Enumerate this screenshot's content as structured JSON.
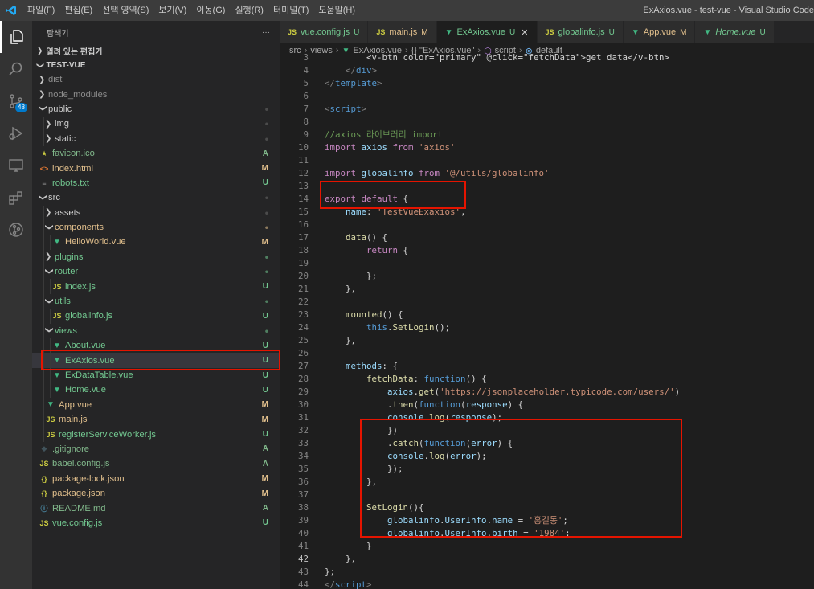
{
  "titlebar": {
    "menus": [
      "파일(F)",
      "편집(E)",
      "선택 영역(S)",
      "보기(V)",
      "이동(G)",
      "실행(R)",
      "터미널(T)",
      "도움말(H)"
    ],
    "window_title": "ExAxios.vue - test-vue - Visual Studio Code"
  },
  "activitybar": {
    "scm_badge": "48"
  },
  "sidebar": {
    "title": "탐색기",
    "more": "···",
    "open_editors": "열려 있는 편집기",
    "project": "TEST-VUE",
    "tree": [
      {
        "depth": 1,
        "type": "folder",
        "open": false,
        "label": "dist",
        "status": "",
        "color": "#8c8c8c"
      },
      {
        "depth": 1,
        "type": "folder",
        "open": false,
        "label": "node_modules",
        "status": "",
        "color": "#8c8c8c"
      },
      {
        "depth": 1,
        "type": "folder",
        "open": true,
        "label": "public",
        "status": "•",
        "color": "#cccccc"
      },
      {
        "depth": 2,
        "type": "folder",
        "open": false,
        "label": "img",
        "status": "•",
        "color": "#cccccc"
      },
      {
        "depth": 2,
        "type": "folder",
        "open": false,
        "label": "static",
        "status": "•",
        "color": "#cccccc"
      },
      {
        "depth": 1,
        "type": "file",
        "icon": "star",
        "label": "favicon.ico",
        "status": "A",
        "color": "#81b88b"
      },
      {
        "depth": 1,
        "type": "file",
        "icon": "html",
        "label": "index.html",
        "status": "M",
        "color": "#e2c08d"
      },
      {
        "depth": 1,
        "type": "file",
        "icon": "txt",
        "label": "robots.txt",
        "status": "U",
        "color": "#73c991"
      },
      {
        "depth": 1,
        "type": "folder",
        "open": true,
        "label": "src",
        "status": "•",
        "color": "#cccccc"
      },
      {
        "depth": 2,
        "type": "folder",
        "open": false,
        "label": "assets",
        "status": "•",
        "color": "#cccccc"
      },
      {
        "depth": 2,
        "type": "folder",
        "open": true,
        "label": "components",
        "status": "•",
        "color": "#e2c08d"
      },
      {
        "depth": 3,
        "type": "file",
        "icon": "vue",
        "label": "HelloWorld.vue",
        "status": "M",
        "color": "#e2c08d"
      },
      {
        "depth": 2,
        "type": "folder",
        "open": false,
        "label": "plugins",
        "status": "•",
        "color": "#73c991"
      },
      {
        "depth": 2,
        "type": "folder",
        "open": true,
        "label": "router",
        "status": "•",
        "color": "#73c991"
      },
      {
        "depth": 3,
        "type": "file",
        "icon": "js",
        "label": "index.js",
        "status": "U",
        "color": "#73c991"
      },
      {
        "depth": 2,
        "type": "folder",
        "open": true,
        "label": "utils",
        "status": "•",
        "color": "#73c991"
      },
      {
        "depth": 3,
        "type": "file",
        "icon": "js",
        "label": "globalinfo.js",
        "status": "U",
        "color": "#73c991"
      },
      {
        "depth": 2,
        "type": "folder",
        "open": true,
        "label": "views",
        "status": "•",
        "color": "#73c991"
      },
      {
        "depth": 3,
        "type": "file",
        "icon": "vue",
        "label": "About.vue",
        "status": "U",
        "color": "#73c991"
      },
      {
        "depth": 3,
        "type": "file",
        "icon": "vue",
        "label": "ExAxios.vue",
        "status": "U",
        "color": "#73c991",
        "selected": true
      },
      {
        "depth": 3,
        "type": "file",
        "icon": "vue",
        "label": "ExDataTable.vue",
        "status": "U",
        "color": "#73c991"
      },
      {
        "depth": 3,
        "type": "file",
        "icon": "vue",
        "label": "Home.vue",
        "status": "U",
        "color": "#73c991"
      },
      {
        "depth": 2,
        "type": "file",
        "icon": "vue",
        "label": "App.vue",
        "status": "M",
        "color": "#e2c08d"
      },
      {
        "depth": 2,
        "type": "file",
        "icon": "js",
        "label": "main.js",
        "status": "M",
        "color": "#e2c08d"
      },
      {
        "depth": 2,
        "type": "file",
        "icon": "js",
        "label": "registerServiceWorker.js",
        "status": "U",
        "color": "#73c991"
      },
      {
        "depth": 1,
        "type": "file",
        "icon": "git",
        "label": ".gitignore",
        "status": "A",
        "color": "#81b88b"
      },
      {
        "depth": 1,
        "type": "file",
        "icon": "js",
        "label": "babel.config.js",
        "status": "A",
        "color": "#81b88b"
      },
      {
        "depth": 1,
        "type": "file",
        "icon": "json",
        "label": "package-lock.json",
        "status": "M",
        "color": "#e2c08d"
      },
      {
        "depth": 1,
        "type": "file",
        "icon": "json",
        "label": "package.json",
        "status": "M",
        "color": "#e2c08d"
      },
      {
        "depth": 1,
        "type": "file",
        "icon": "info",
        "label": "README.md",
        "status": "A",
        "color": "#81b88b"
      },
      {
        "depth": 1,
        "type": "file",
        "icon": "js",
        "label": "vue.config.js",
        "status": "U",
        "color": "#73c991"
      }
    ]
  },
  "tabs": [
    {
      "icon": "js",
      "label": "vue.config.js",
      "flag": "U"
    },
    {
      "icon": "js",
      "label": "main.js",
      "flag": "M"
    },
    {
      "icon": "vue",
      "label": "ExAxios.vue",
      "flag": "U",
      "active": true
    },
    {
      "icon": "js",
      "label": "globalinfo.js",
      "flag": "U"
    },
    {
      "icon": "vue",
      "label": "App.vue",
      "flag": "M"
    },
    {
      "icon": "vue",
      "label": "Home.vue",
      "flag": "U",
      "italic": true
    }
  ],
  "breadcrumb": [
    "src",
    "views",
    "ExAxios.vue",
    "{} \"ExAxios.vue\"",
    "script",
    "default"
  ],
  "code_lines": [
    {
      "n": "3",
      "t": [
        [
          "t-pl",
          "        <v-btn color=\"primary\" @click=\"fetchData\">get data</v-btn>"
        ]
      ]
    },
    {
      "n": "4",
      "t": [
        [
          "t-pl",
          "    "
        ],
        [
          "t-tag",
          "</"
        ],
        [
          "t-tn",
          "div"
        ],
        [
          "t-tag",
          ">"
        ]
      ]
    },
    {
      "n": "5",
      "t": [
        [
          "t-tag",
          "</"
        ],
        [
          "t-tn",
          "template"
        ],
        [
          "t-tag",
          ">"
        ]
      ]
    },
    {
      "n": "6",
      "t": []
    },
    {
      "n": "7",
      "t": [
        [
          "t-tag",
          "<"
        ],
        [
          "t-tn",
          "script"
        ],
        [
          "t-tag",
          ">"
        ]
      ]
    },
    {
      "n": "8",
      "t": []
    },
    {
      "n": "9",
      "t": [
        [
          "t-cm",
          "//axios 라이브러리 import"
        ]
      ]
    },
    {
      "n": "10",
      "t": [
        [
          "t-kw",
          "import "
        ],
        [
          "t-vr",
          "axios "
        ],
        [
          "t-kw",
          "from "
        ],
        [
          "t-st",
          "'axios'"
        ]
      ]
    },
    {
      "n": "11",
      "t": []
    },
    {
      "n": "12",
      "t": [
        [
          "t-kw",
          "import "
        ],
        [
          "t-vr",
          "globalinfo "
        ],
        [
          "t-kw",
          "from "
        ],
        [
          "t-st",
          "'@/utils/globalinfo'"
        ]
      ]
    },
    {
      "n": "13",
      "t": []
    },
    {
      "n": "14",
      "t": [
        [
          "t-kw",
          "export default "
        ],
        [
          "t-pl",
          "{"
        ]
      ]
    },
    {
      "n": "15",
      "t": [
        [
          "t-pl",
          "    "
        ],
        [
          "t-vr",
          "name"
        ],
        [
          "t-pl",
          ": "
        ],
        [
          "t-st",
          "'TestVueExaxios'"
        ],
        [
          "t-pl",
          ","
        ]
      ]
    },
    {
      "n": "16",
      "t": []
    },
    {
      "n": "17",
      "t": [
        [
          "t-pl",
          "    "
        ],
        [
          "t-fn",
          "data"
        ],
        [
          "t-pl",
          "() {"
        ]
      ]
    },
    {
      "n": "18",
      "t": [
        [
          "t-pl",
          "        "
        ],
        [
          "t-kw",
          "return "
        ],
        [
          "t-pl",
          "{"
        ]
      ]
    },
    {
      "n": "19",
      "t": []
    },
    {
      "n": "20",
      "t": [
        [
          "t-pl",
          "        };"
        ]
      ]
    },
    {
      "n": "21",
      "t": [
        [
          "t-pl",
          "    },"
        ]
      ]
    },
    {
      "n": "22",
      "t": []
    },
    {
      "n": "23",
      "t": [
        [
          "t-pl",
          "    "
        ],
        [
          "t-fn",
          "mounted"
        ],
        [
          "t-pl",
          "() {"
        ]
      ]
    },
    {
      "n": "24",
      "t": [
        [
          "t-pl",
          "        "
        ],
        [
          "t-bl",
          "this"
        ],
        [
          "t-pl",
          "."
        ],
        [
          "t-fn",
          "SetLogin"
        ],
        [
          "t-pl",
          "();"
        ]
      ]
    },
    {
      "n": "25",
      "t": [
        [
          "t-pl",
          "    },"
        ]
      ]
    },
    {
      "n": "26",
      "t": []
    },
    {
      "n": "27",
      "t": [
        [
          "t-pl",
          "    "
        ],
        [
          "t-vr",
          "methods"
        ],
        [
          "t-pl",
          ": {"
        ]
      ]
    },
    {
      "n": "28",
      "t": [
        [
          "t-pl",
          "        "
        ],
        [
          "t-fn",
          "fetchData"
        ],
        [
          "t-pl",
          ": "
        ],
        [
          "t-bl",
          "function"
        ],
        [
          "t-pl",
          "() {"
        ]
      ]
    },
    {
      "n": "29",
      "t": [
        [
          "t-pl",
          "            "
        ],
        [
          "t-vr",
          "axios"
        ],
        [
          "t-pl",
          "."
        ],
        [
          "t-fn",
          "get"
        ],
        [
          "t-pl",
          "("
        ],
        [
          "t-st",
          "'https://jsonplaceholder.typicode.com/users/'"
        ],
        [
          "t-pl",
          ")"
        ]
      ]
    },
    {
      "n": "30",
      "t": [
        [
          "t-pl",
          "            ."
        ],
        [
          "t-fn",
          "then"
        ],
        [
          "t-pl",
          "("
        ],
        [
          "t-bl",
          "function"
        ],
        [
          "t-pl",
          "("
        ],
        [
          "t-vr",
          "response"
        ],
        [
          "t-pl",
          ") {"
        ]
      ]
    },
    {
      "n": "31",
      "t": [
        [
          "t-pl",
          "            "
        ],
        [
          "t-vr",
          "console"
        ],
        [
          "t-pl",
          "."
        ],
        [
          "t-fn",
          "log"
        ],
        [
          "t-pl",
          "("
        ],
        [
          "t-vr",
          "response"
        ],
        [
          "t-pl",
          ");"
        ]
      ]
    },
    {
      "n": "32",
      "t": [
        [
          "t-pl",
          "            })"
        ]
      ]
    },
    {
      "n": "33",
      "t": [
        [
          "t-pl",
          "            ."
        ],
        [
          "t-fn",
          "catch"
        ],
        [
          "t-pl",
          "("
        ],
        [
          "t-bl",
          "function"
        ],
        [
          "t-pl",
          "("
        ],
        [
          "t-vr",
          "error"
        ],
        [
          "t-pl",
          ") {"
        ]
      ]
    },
    {
      "n": "34",
      "t": [
        [
          "t-pl",
          "            "
        ],
        [
          "t-vr",
          "console"
        ],
        [
          "t-pl",
          "."
        ],
        [
          "t-fn",
          "log"
        ],
        [
          "t-pl",
          "("
        ],
        [
          "t-vr",
          "error"
        ],
        [
          "t-pl",
          ");"
        ]
      ]
    },
    {
      "n": "35",
      "t": [
        [
          "t-pl",
          "            });"
        ]
      ]
    },
    {
      "n": "36",
      "t": [
        [
          "t-pl",
          "        },"
        ]
      ]
    },
    {
      "n": "37",
      "t": []
    },
    {
      "n": "38",
      "t": [
        [
          "t-pl",
          "        "
        ],
        [
          "t-fn",
          "SetLogin"
        ],
        [
          "t-pl",
          "(){"
        ]
      ]
    },
    {
      "n": "39",
      "t": [
        [
          "t-pl",
          "            "
        ],
        [
          "t-vr",
          "globalinfo"
        ],
        [
          "t-pl",
          "."
        ],
        [
          "t-vr",
          "UserInfo"
        ],
        [
          "t-pl",
          "."
        ],
        [
          "t-vr",
          "name"
        ],
        [
          "t-pl",
          " = "
        ],
        [
          "t-st",
          "'홍길동'"
        ],
        [
          "t-pl",
          ";"
        ]
      ]
    },
    {
      "n": "40",
      "t": [
        [
          "t-pl",
          "            "
        ],
        [
          "t-vr",
          "globalinfo"
        ],
        [
          "t-pl",
          "."
        ],
        [
          "t-vr",
          "UserInfo"
        ],
        [
          "t-pl",
          "."
        ],
        [
          "t-vr",
          "birth"
        ],
        [
          "t-pl",
          " = "
        ],
        [
          "t-st",
          "'1984'"
        ],
        [
          "t-pl",
          ";"
        ]
      ]
    },
    {
      "n": "41",
      "t": [
        [
          "t-pl",
          "        }"
        ]
      ]
    },
    {
      "n": "42",
      "t": [
        [
          "t-pl",
          "    },"
        ]
      ],
      "cur": true
    },
    {
      "n": "43",
      "t": [
        [
          "t-pl",
          "};"
        ]
      ]
    },
    {
      "n": "44",
      "t": [
        [
          "t-tag",
          "</"
        ],
        [
          "t-tn",
          "script"
        ],
        [
          "t-tag",
          ">"
        ]
      ]
    },
    {
      "n": "45",
      "t": []
    }
  ],
  "colors": {
    "activity_bg": "#333333",
    "sidebar_bg": "#252526",
    "editor_bg": "#1e1e1e",
    "highlight_box": "#e51400"
  }
}
